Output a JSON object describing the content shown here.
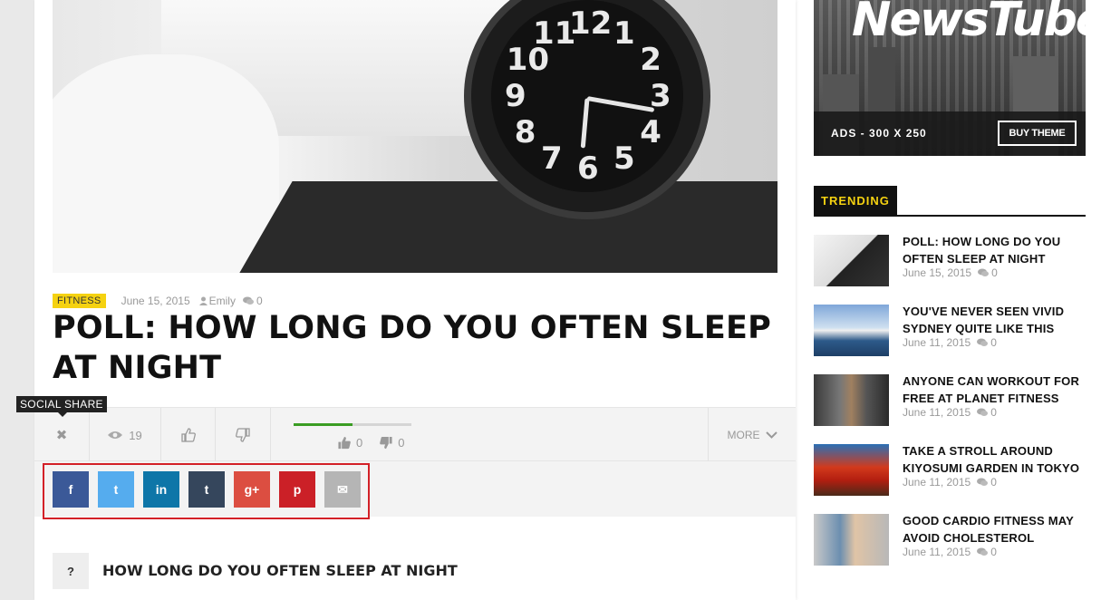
{
  "post": {
    "category": "FITNESS",
    "date": "June 15, 2015",
    "author": "Emily",
    "comments": "0",
    "title": "POLL: HOW LONG DO YOU OFTEN SLEEP AT NIGHT",
    "hero_icon": "alarm-clock-photo",
    "clock_numbers": [
      "12",
      "1",
      "2",
      "3",
      "4",
      "5",
      "6",
      "7",
      "8",
      "9",
      "10",
      "11"
    ]
  },
  "share_bar": {
    "tooltip": "SOCIAL SHARE",
    "views": "19",
    "like_count": "0",
    "dislike_count": "0",
    "vote_fraction": 0.5,
    "more_label": "MORE",
    "vote_color": "#3a9d23"
  },
  "social": [
    {
      "name": "facebook",
      "glyph": "f",
      "color": "#3b5998"
    },
    {
      "name": "twitter",
      "glyph": "t",
      "color": "#55acee"
    },
    {
      "name": "linkedin",
      "glyph": "in",
      "color": "#0e76a8"
    },
    {
      "name": "tumblr",
      "glyph": "t",
      "color": "#35465c"
    },
    {
      "name": "google-plus",
      "glyph": "g+",
      "color": "#dc4e41"
    },
    {
      "name": "pinterest",
      "glyph": "p",
      "color": "#cb2027"
    },
    {
      "name": "email",
      "glyph": "✉",
      "color": "#b5b5b5"
    }
  ],
  "poll": {
    "marker": "?",
    "question": "HOW LONG DO YOU OFTEN SLEEP AT NIGHT"
  },
  "ad": {
    "logo": "NewsTube",
    "label": "ADS - 300 X 250",
    "button": "BUY THEME"
  },
  "trending": {
    "heading": "TRENDING",
    "items": [
      {
        "title": "POLL: HOW LONG DO YOU OFTEN SLEEP AT NIGHT",
        "date": "June 15, 2015",
        "comments": "0"
      },
      {
        "title": "YOU'VE NEVER SEEN VIVID SYDNEY QUITE LIKE THIS",
        "date": "June 11, 2015",
        "comments": "0"
      },
      {
        "title": "ANYONE CAN WORKOUT FOR FREE AT PLANET FITNESS",
        "date": "June 11, 2015",
        "comments": "0"
      },
      {
        "title": "TAKE A STROLL AROUND KIYOSUMI GARDEN IN TOKYO",
        "date": "June 11, 2015",
        "comments": "0"
      },
      {
        "title": "GOOD CARDIO FITNESS MAY AVOID CHOLESTEROL",
        "date": "June 11, 2015",
        "comments": "0"
      }
    ]
  },
  "colors": {
    "accent_yellow": "#f5d211",
    "highlight_red": "#d32027"
  }
}
